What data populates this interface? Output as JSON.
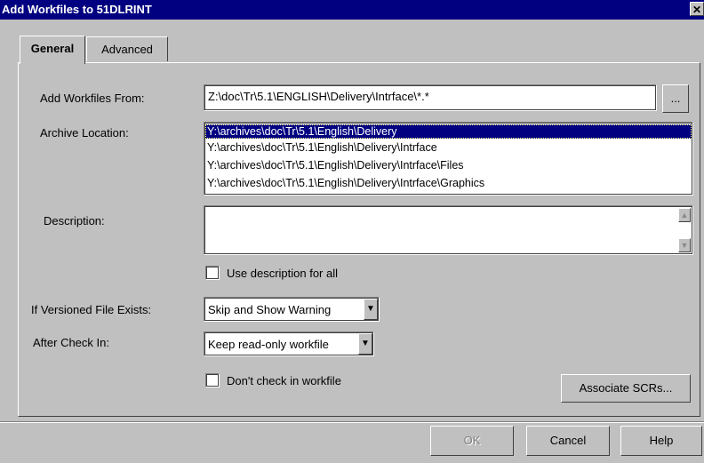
{
  "window": {
    "title": "Add Workfiles to 51DLRINT",
    "close_glyph": "✕"
  },
  "tabs": [
    {
      "label": "General",
      "selected": true
    },
    {
      "label": "Advanced",
      "selected": false
    }
  ],
  "fields": {
    "add_from": {
      "label": "Add Workfiles From:",
      "value": "Z:\\doc\\Tr\\5.1\\ENGLISH\\Delivery\\Intrface\\*.*",
      "browse_label": "..."
    },
    "archive_location": {
      "label": "Archive Location:",
      "items": [
        "Y:\\archives\\doc\\Tr\\5.1\\English\\Delivery",
        "Y:\\archives\\doc\\Tr\\5.1\\English\\Delivery\\Intrface",
        "Y:\\archives\\doc\\Tr\\5.1\\English\\Delivery\\Intrface\\Files",
        "Y:\\archives\\doc\\Tr\\5.1\\English\\Delivery\\Intrface\\Graphics"
      ],
      "selected_index": 0
    },
    "description": {
      "label": "Description:",
      "value": ""
    },
    "use_description_for_all": {
      "label": "Use description for all",
      "checked": false
    },
    "if_versioned_exists": {
      "label": "If Versioned File Exists:",
      "value": "Skip and Show Warning"
    },
    "after_check_in": {
      "label": "After Check In:",
      "value": "Keep read-only workfile"
    },
    "dont_check_in": {
      "label": "Don't check in workfile",
      "checked": false
    }
  },
  "buttons": {
    "associate_scrs": "Associate SCRs...",
    "ok": "OK",
    "cancel": "Cancel",
    "help": "Help"
  },
  "icons": {
    "dropdown": "chevron-down-icon",
    "scroll_up": "scroll-up-icon",
    "scroll_down": "scroll-down-icon"
  }
}
